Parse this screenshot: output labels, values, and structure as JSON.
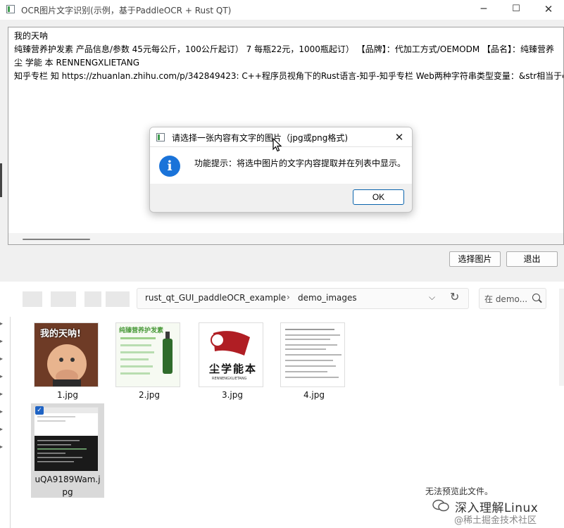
{
  "window": {
    "title": "OCR图片文字识别(示例，基于PaddleOCR + Rust QT)",
    "minimize_glyph": "─",
    "maximize_glyph": "☐",
    "close_glyph": "✕"
  },
  "ocr_text": {
    "lines": [
      "我的天呐",
      "纯臻营养护发素 产品信息/参数 45元每公斤，100公斤起订） 7 每瓶22元，1000瓶起订） 【品牌】：代加工方式/OEMODM 【品名】：纯臻营养",
      "尘 学能 本 RENNENGXLIETANG",
      "知乎专栏 知 https://zhuanlan.zhihu.com/p/342849423: C++程序员视角下的Rust语言-知乎-知乎专栏 Web两种字符串类型变量：&str相当于c"
    ]
  },
  "buttons": {
    "select_image": "选择图片",
    "exit": "退出"
  },
  "dialog": {
    "title": "请选择一张内容有文字的图片（jpg或png格式)",
    "message": "功能提示：将选中图片的文字内容提取并在列表中显示。",
    "ok": "OK",
    "info_glyph": "i",
    "close_glyph": "✕"
  },
  "explorer": {
    "breadcrumb": [
      "rust_qt_GUI_paddleOCR_example",
      "demo_images"
    ],
    "breadcrumb_sep": "›",
    "dropdown_glyph": "⌵",
    "refresh_glyph": "↻",
    "search_placeholder": "在 demo...",
    "files": [
      {
        "name": "1.jpg",
        "selected": false,
        "caption": "我的天呐!"
      },
      {
        "name": "2.jpg",
        "selected": false,
        "caption": "纯臻营养护发素"
      },
      {
        "name": "3.jpg",
        "selected": false,
        "caption": "尘学能本"
      },
      {
        "name": "4.jpg",
        "selected": false,
        "caption": ""
      },
      {
        "name": "uQA9189Wam.jpg",
        "selected": true,
        "caption": ""
      }
    ],
    "file5_line1": "uQA9189Wam.j",
    "file5_line2": "pg",
    "preview_message": "无法预览此文件。",
    "check_glyph": "✓"
  },
  "watermark": {
    "line1": "深入理解Linux",
    "line2": "@稀土掘金技术社区"
  },
  "thumb3_sub": "RENNENGXLIETANG"
}
